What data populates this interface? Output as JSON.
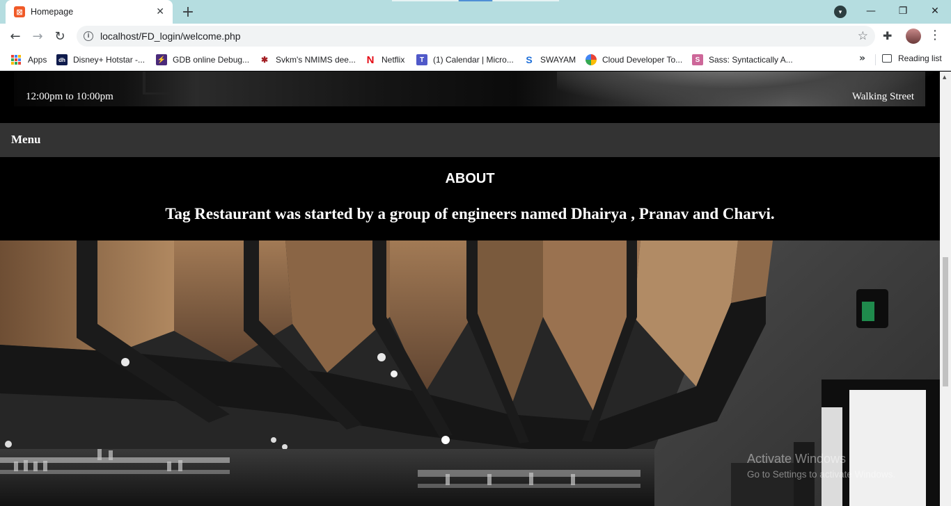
{
  "browser": {
    "tab_title": "Homepage",
    "url": "localhost/FD_login/welcome.php",
    "icons": {
      "tab_favicon": "xampp-icon",
      "close": "close-icon",
      "new_tab": "plus-icon",
      "back": "back-arrow-icon",
      "forward": "forward-arrow-icon",
      "reload": "reload-icon",
      "site_info": "info-icon",
      "bookmark_star": "star-icon",
      "extensions": "puzzle-icon",
      "menu": "kebab-menu-icon"
    },
    "glyphs": {
      "tab_favicon": "⊠",
      "close": "✕",
      "new_tab": "+",
      "back": "←",
      "forward": "→",
      "reload": "↻",
      "site_info": "i",
      "star": "☆",
      "extensions": "✚",
      "kebab": "⋮",
      "minimize": "—",
      "maximize": "❐",
      "window_close": "✕",
      "chevron": "▾",
      "more": "»"
    }
  },
  "bookmarks": {
    "items": [
      {
        "label": "Apps"
      },
      {
        "label": "Disney+ Hotstar -..."
      },
      {
        "label": "GDB online Debug..."
      },
      {
        "label": "Svkm's NMIMS dee..."
      },
      {
        "label": "Netflix"
      },
      {
        "label": "(1) Calendar | Micro..."
      },
      {
        "label": "SWAYAM"
      },
      {
        "label": "Cloud Developer To..."
      },
      {
        "label": "Sass: Syntactically A..."
      }
    ],
    "reading_list": "Reading list"
  },
  "page": {
    "hours": "12:00pm to 10:00pm",
    "street": "Walking Street",
    "menu": "Menu",
    "about_heading": "ABOUT",
    "about_text": "Tag Restaurant was started by a group of engineers named Dhairya , Pranav and Charvi."
  },
  "os": {
    "activate_title": "Activate Windows",
    "activate_sub": "Go to Settings to activate Windows."
  },
  "colors": {
    "tab_strip": "#b5dde0",
    "menu_bar": "#333333",
    "page_bg": "#000000"
  }
}
